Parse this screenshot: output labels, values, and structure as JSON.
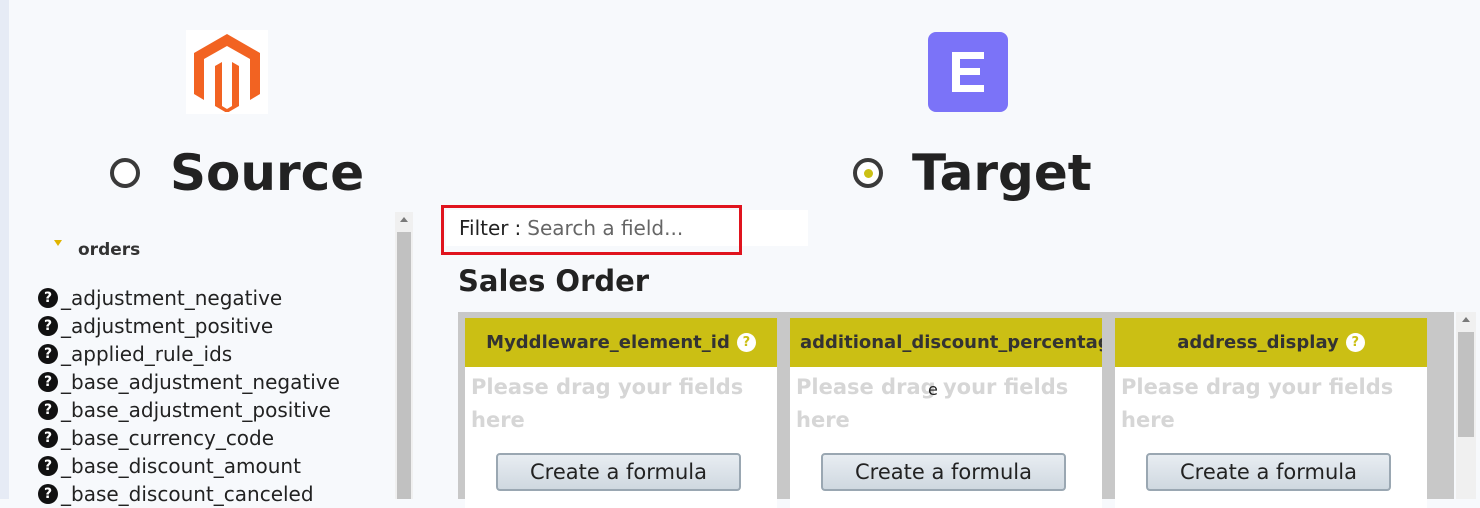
{
  "source": {
    "title": "Source",
    "tree_root": "orders",
    "fields": [
      "_adjustment_negative",
      "_adjustment_positive",
      "_applied_rule_ids",
      "_base_adjustment_negative",
      "_base_adjustment_positive",
      "_base_currency_code",
      "_base_discount_amount",
      "_base_discount_canceled"
    ],
    "help_icon_glyph": "?"
  },
  "target": {
    "title": "Target",
    "logo_letter": "E",
    "filter": {
      "label": "Filter",
      "separator": ":",
      "placeholder": "Search a field..."
    },
    "module_title": "Sales Order",
    "columns": [
      {
        "name": "Myddleware_element_id",
        "help": true
      },
      {
        "name": "additional_discount_percentag",
        "help": false
      },
      {
        "name": "address_display",
        "help": true
      }
    ],
    "drop_hint": "Please drag your fields here",
    "formula_button": "Create a formula",
    "stray_text": "e"
  },
  "colors": {
    "magento_logo": "#f26322",
    "target_logo_bg": "#7b73f8",
    "column_header": "#cbbf14",
    "filter_highlight": "#e0141e",
    "selected_radio_dot": "#cbc014"
  }
}
